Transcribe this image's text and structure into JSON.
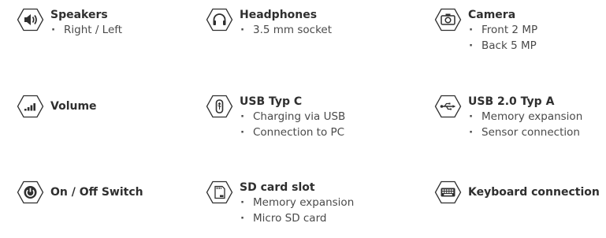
{
  "features": [
    {
      "id": "speakers",
      "icon": "speaker-icon",
      "title": "Speakers",
      "items": [
        "Right / Left"
      ]
    },
    {
      "id": "headphones",
      "icon": "headphones-icon",
      "title": "Headphones",
      "items": [
        "3.5 mm socket"
      ]
    },
    {
      "id": "camera",
      "icon": "camera-icon",
      "title": "Camera",
      "items": [
        "Front 2 MP",
        "Back 5 MP"
      ]
    },
    {
      "id": "volume",
      "icon": "volume-icon",
      "title": "Volume",
      "items": []
    },
    {
      "id": "usb-c",
      "icon": "usb-c-icon",
      "title": "USB Typ C",
      "items": [
        "Charging via USB",
        "Connection to PC"
      ]
    },
    {
      "id": "usb-a",
      "icon": "usb-icon",
      "title": "USB 2.0 Typ A",
      "items": [
        "Memory expansion",
        "Sensor connection"
      ]
    },
    {
      "id": "power",
      "icon": "power-icon",
      "title": "On / Off Switch",
      "items": []
    },
    {
      "id": "sd",
      "icon": "sd-card-icon",
      "title": "SD card slot",
      "items": [
        "Memory expansion",
        "Micro SD card"
      ]
    },
    {
      "id": "keyboard",
      "icon": "keyboard-icon",
      "title": "Keyboard connection",
      "items": []
    }
  ],
  "colors": {
    "icon": "#2f2f2f",
    "text": "#3a3a3a"
  }
}
